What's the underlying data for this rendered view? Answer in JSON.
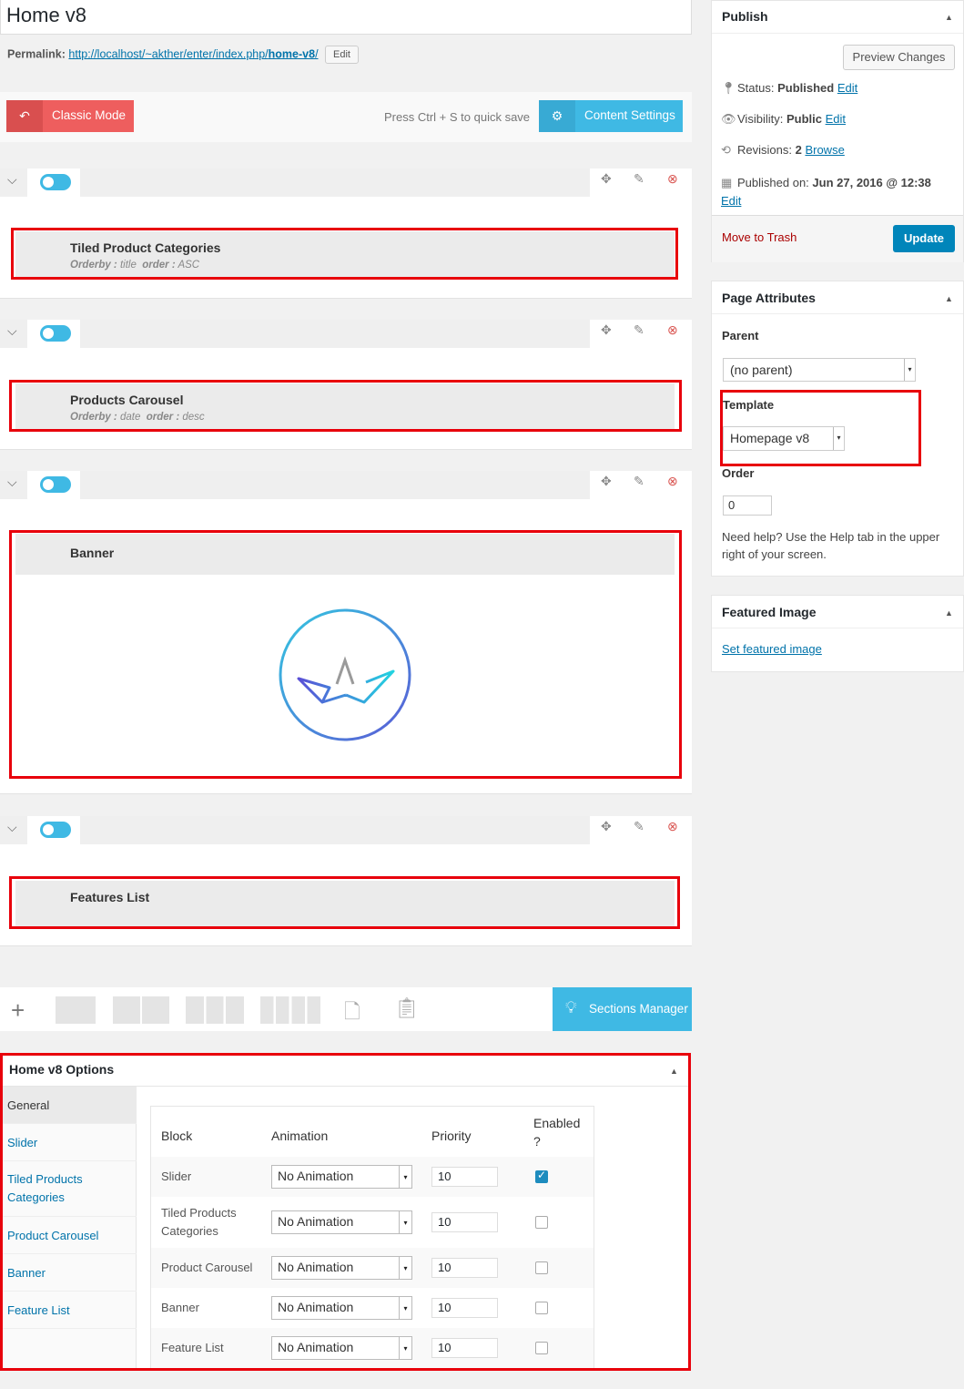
{
  "editor": {
    "title": "Home v8",
    "permalink_label": "Permalink:",
    "permalink_base": "http://localhost/~akther/enter/index.php/",
    "permalink_slug": "home-v8",
    "permalink_tail": "/",
    "permalink_edit": "Edit"
  },
  "builder": {
    "classic_mode": "Classic Mode",
    "quick_save_hint": "Press Ctrl + S to quick save",
    "content_settings": "Content Settings",
    "sections_manager": "Sections Manager"
  },
  "sections": [
    {
      "title": "Tiled Product Categories",
      "orderby_label": "Orderby :",
      "orderby": "title",
      "order_label": "order :",
      "order": "ASC"
    },
    {
      "title": "Products Carousel",
      "orderby_label": "Orderby :",
      "orderby": "date",
      "order_label": "order :",
      "order": "desc"
    },
    {
      "title": "Banner"
    },
    {
      "title": "Features List"
    }
  ],
  "options": {
    "title": "Home v8 Options",
    "nav": [
      "General",
      "Slider",
      "Tiled Products Categories",
      "Product Carousel",
      "Banner",
      "Feature List"
    ],
    "headers": {
      "block": "Block",
      "animation": "Animation",
      "priority": "Priority",
      "enabled": "Enabled ?"
    },
    "rows": [
      {
        "block": "Slider",
        "animation": "No Animation",
        "priority": "10",
        "enabled": true
      },
      {
        "block": "Tiled Products Categories",
        "animation": "No Animation",
        "priority": "10",
        "enabled": false
      },
      {
        "block": "Product Carousel",
        "animation": "No Animation",
        "priority": "10",
        "enabled": false
      },
      {
        "block": "Banner",
        "animation": "No Animation",
        "priority": "10",
        "enabled": false
      },
      {
        "block": "Feature List",
        "animation": "No Animation",
        "priority": "10",
        "enabled": false
      }
    ]
  },
  "publish": {
    "title": "Publish",
    "preview": "Preview Changes",
    "status_label": "Status:",
    "status": "Published",
    "visibility_label": "Visibility:",
    "visibility": "Public",
    "revisions_label": "Revisions:",
    "revisions": "2",
    "browse": "Browse",
    "published_on_label": "Published on:",
    "published_on": "Jun 27, 2016 @ 12:38",
    "edit": "Edit",
    "trash": "Move to Trash",
    "update": "Update"
  },
  "page_attributes": {
    "title": "Page Attributes",
    "parent_label": "Parent",
    "parent_value": "(no parent)",
    "template_label": "Template",
    "template_value": "Homepage v8",
    "order_label": "Order",
    "order_value": "0",
    "help_text": "Need help? Use the Help tab in the upper right of your screen."
  },
  "featured_image": {
    "title": "Featured Image",
    "link": "Set featured image"
  },
  "colors": {
    "accent": "#3fb9e4",
    "danger": "#ee5e5e",
    "highlight": "#e8000b",
    "wp_blue": "#0085ba"
  }
}
